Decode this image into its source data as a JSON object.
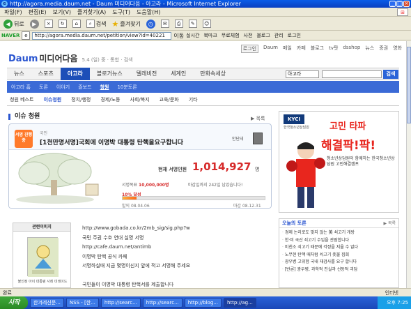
{
  "window": {
    "title": "http://agora.media.daum.net - Daum 미디어다음 - 아고라 - Microsoft Internet Explorer"
  },
  "menu": [
    "파일(F)",
    "편집(E)",
    "보기(V)",
    "즐겨찾기(A)",
    "도구(T)",
    "도움말(H)"
  ],
  "toolbar": {
    "back": "뒤로",
    "search": "검색",
    "favorites": "즐겨찾기"
  },
  "address": {
    "brand": "NAVER",
    "url": "http://agora.media.daum.net/petition/view?id=40221",
    "go": "이동",
    "extras": [
      "실시간",
      "북마크",
      "무료체험",
      "사전",
      "블로그",
      "관리",
      "로그인"
    ]
  },
  "site": {
    "topnav": [
      "로그인",
      "Daum",
      "메일",
      "카페",
      "블로그",
      "tv팟",
      "dsshop",
      "뉴스",
      "증권",
      "영화"
    ],
    "logo_daum": "Daum",
    "logo_media": "미디어다음",
    "logo_sub": "5.4 (일) 중 · 통합 · 검색"
  },
  "mainnav": {
    "items": [
      "뉴스",
      "스포츠",
      "아고라",
      "블로거뉴스",
      "텔레비전",
      "세계인",
      "만화속세상"
    ],
    "active_index": 2,
    "search_select": "아고라",
    "search_button": "검색"
  },
  "subnav": {
    "items": [
      "아고라 홈",
      "토론",
      "이야기",
      "즐보드",
      "청원",
      "10분토론"
    ],
    "active_index": 4
  },
  "tabs": {
    "items": [
      "청원 베스트",
      "이슈청원",
      "정치/행정",
      "경제/노동",
      "사회/복지",
      "교육/문화",
      "기타"
    ],
    "active_index": 1
  },
  "section": {
    "title": "이슈 청원",
    "more": "▶ 목록"
  },
  "petition": {
    "badge": "서명 진행중",
    "category": "국민",
    "title": "[1천만명서명]국회에 이명박 대통령 탄핵을요구합니다",
    "author": "안단테",
    "current_label": "현재 서명인원",
    "current_count": "1,014,927",
    "current_unit": "명",
    "target_label": "서명목표",
    "target_value": "10,000,000명",
    "deadline": "마감일까지 242일 남았습니다!",
    "percent_label": "10% 달성",
    "percent_value": 10,
    "start_date": "발의 08.04.06",
    "end_date": "마감 08.12.31"
  },
  "related": {
    "header": "관련이미지",
    "caption": "불인정 아이 대통령 사례 미레이드"
  },
  "body_lines": [
    "http://www.gobada.co.kr/2mb_sig/sig.php?w",
    "국민 주권 수호 연대 실명 서명",
    "http://cafe.daum.net/antimb",
    "이명박 탄핵 공식 카페",
    "서명하실때 지금 몇명이신지 앞에 적고 서명해 주세요",
    "",
    "국민들이 이명박 대통령 탄핵서를 제출합니다"
  ],
  "ad": {
    "brand": "KYCI",
    "brand_sub": "한국청소년상담원",
    "headline1": "고민 타파",
    "headline2": "해결팍!팍!",
    "text": "청소년상담원이 함께하는 한국청소년상담원 고민해결캠프"
  },
  "news": {
    "header": "오늘의 토론",
    "more": "▶ 목록",
    "items": [
      "경제 논리로도 맞지 않는 美 쇠고기 개방",
      "한·미 국산 쇠고기 수입을 관람합니다",
      "미친소 쇠고기 때문에 걱정을 지울 수 없다",
      "노무현 탄핵 때처럼 쇠고기 촛불 집회",
      "광우병 고위험 국내 재검사를 요구 합니다",
      "[반론] 광우병, 과학적 진실과 선동적 괴담"
    ]
  },
  "status": {
    "left": "완료",
    "zone": "인터넷"
  },
  "taskbar": {
    "start": "시작",
    "tasks": [
      "한겨레신문...",
      "NSS - [한...",
      "http://searc...",
      "http://searc...",
      "http://blog...",
      "http://ag..."
    ],
    "active_index": 5,
    "clock": "오후 7:25"
  }
}
